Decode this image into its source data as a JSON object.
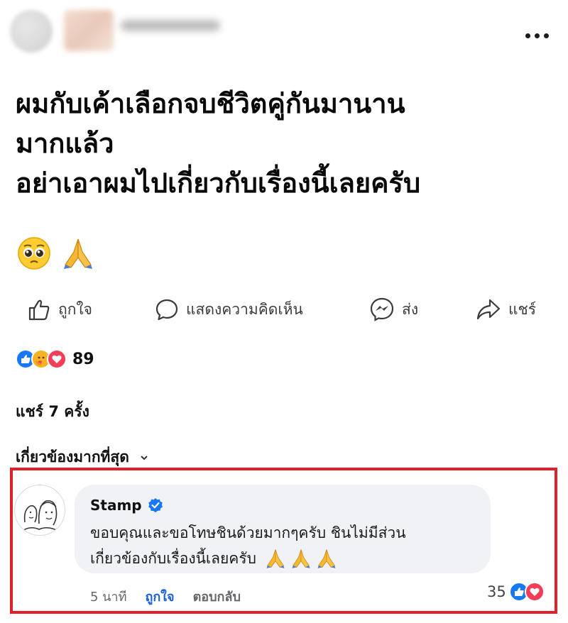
{
  "post": {
    "lines": [
      "ผมกับเค้าเลือกจบชีวิตคู่กันมานาน",
      "มากแล้ว",
      "อย่าเอาผมไปเกี่ยวกับเรื่องนี้เลยครับ"
    ],
    "emojis": [
      "pleading-face",
      "folded-hands"
    ]
  },
  "actions": {
    "like": "ถูกใจ",
    "comment": "แสดงความคิดเห็น",
    "send": "ส่ง",
    "share": "แชร์"
  },
  "reactions": {
    "icons": [
      "like",
      "care",
      "love"
    ],
    "count": "89"
  },
  "shares": "แชร์ 7 ครั้ง",
  "sort": "เกี่ยวข้องมากที่สุด",
  "comment": {
    "name": "Stamp",
    "verified": true,
    "lines": [
      "ขอบคุณและขอโทษชินด้วยมากๆครับ ชินไม่มีส่วน",
      "เกี่ยวข้องกับเรื่องนี้เลยครับ"
    ],
    "time": "5 นาที",
    "like": "ถูกใจ",
    "reply": "ตอบกลับ",
    "reaction_count": "35"
  },
  "colors": {
    "highlight_border": "#e0202a",
    "like_blue": "#1b5fd9",
    "bubble_bg": "#f0f2f5"
  }
}
